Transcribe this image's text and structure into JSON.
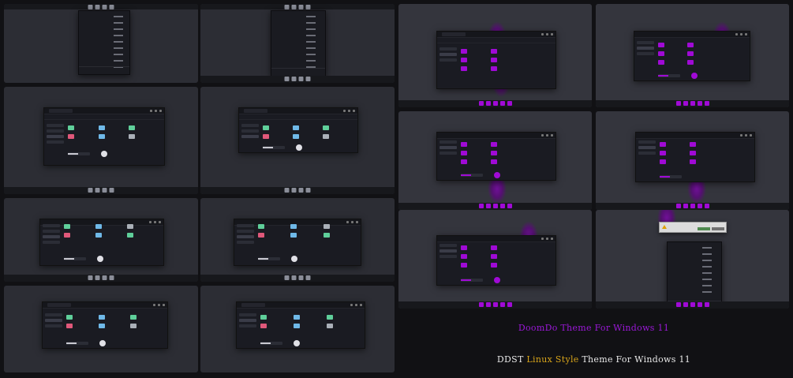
{
  "caption_main": "DoomDo Theme For Windows 11",
  "caption_sub": {
    "part1": "DDST",
    "part2": "Linux Style",
    "part3": "Theme For Windows 11"
  },
  "colors": {
    "accent_purple": "#a00ad6",
    "caption_gold": "#d6a31a",
    "folder_green": "#5fcf9a",
    "folder_blue": "#6fb9e8",
    "folder_pink": "#e0587a",
    "folder_grey": "#aab0b8"
  },
  "icons": [
    "folder-icon",
    "drive-icon",
    "disc-icon",
    "warning-icon"
  ],
  "screenshots": [
    {
      "id": "start-menu-1"
    },
    {
      "id": "start-menu-2"
    },
    {
      "id": "explorer-1"
    },
    {
      "id": "explorer-2"
    },
    {
      "id": "explorer-3"
    },
    {
      "id": "explorer-4"
    },
    {
      "id": "explorer-5"
    },
    {
      "id": "explorer-6"
    },
    {
      "id": "purple-explorer-1"
    },
    {
      "id": "purple-explorer-2"
    },
    {
      "id": "purple-explorer-3"
    },
    {
      "id": "purple-explorer-4"
    },
    {
      "id": "purple-explorer-5"
    },
    {
      "id": "purple-dialog-menu"
    }
  ]
}
